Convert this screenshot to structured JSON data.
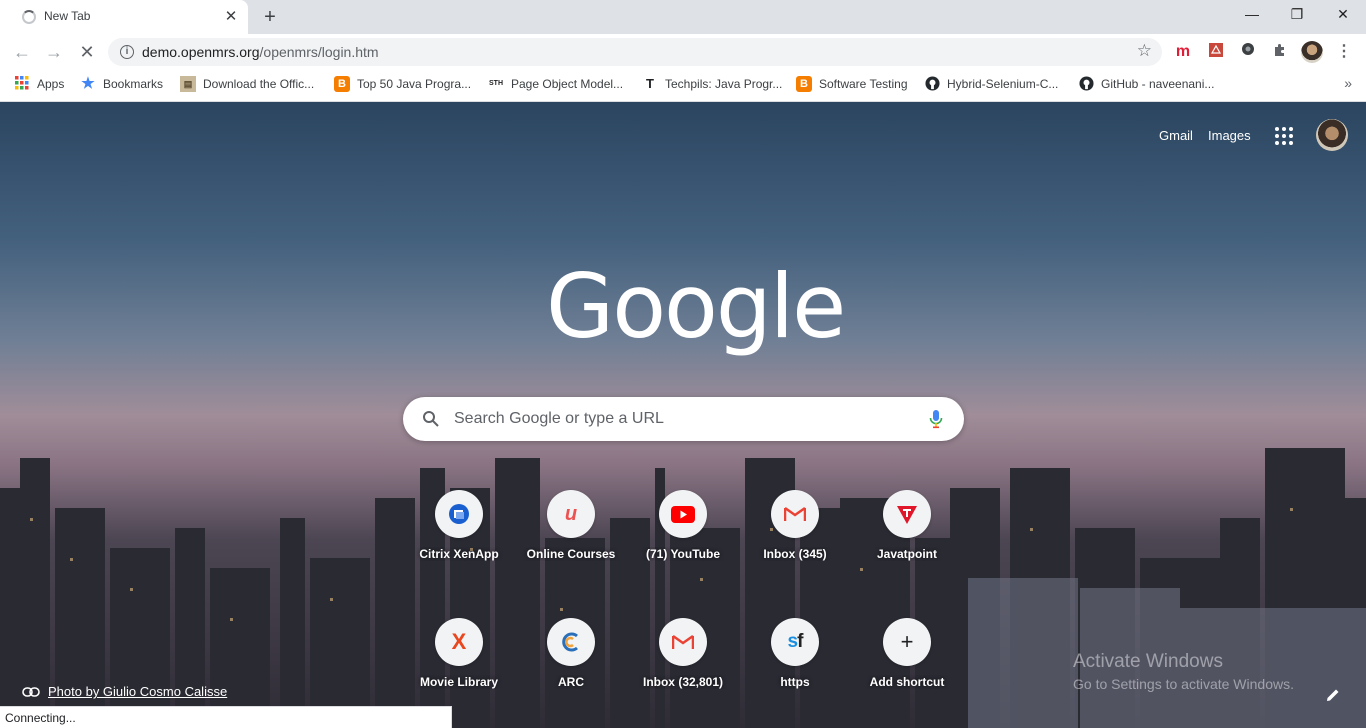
{
  "browser": {
    "tab_title": "New Tab",
    "url_host": "demo.openmrs.org",
    "url_path": "/openmrs/login.htm",
    "status": "Connecting..."
  },
  "bookmarks": [
    {
      "label": "Apps",
      "icon": "apps-grid-icon"
    },
    {
      "label": "Bookmarks",
      "icon": "star-icon"
    },
    {
      "label": "Download the Offic...",
      "icon": "page-icon"
    },
    {
      "label": "Top 50 Java Progra...",
      "icon": "blogger-icon"
    },
    {
      "label": "Page Object Model...",
      "icon": "sth-icon"
    },
    {
      "label": "Techpils: Java Progr...",
      "icon": "t-icon"
    },
    {
      "label": "Software Testing",
      "icon": "blogger-icon"
    },
    {
      "label": "Hybrid-Selenium-C...",
      "icon": "github-icon"
    },
    {
      "label": "GitHub - naveenani...",
      "icon": "github-icon"
    }
  ],
  "ntp": {
    "gmail": "Gmail",
    "images": "Images",
    "logo": "Google",
    "search_placeholder": "Search Google or type a URL",
    "attribution": "Photo by Giulio Cosmo Calisse",
    "watermark_title": "Activate Windows",
    "watermark_sub": "Go to Settings to activate Windows."
  },
  "shortcuts": [
    {
      "label": "Citrix XenApp",
      "icon": "citrix-icon"
    },
    {
      "label": "Online Courses",
      "icon": "udemy-icon"
    },
    {
      "label": "(71) YouTube",
      "icon": "youtube-icon"
    },
    {
      "label": "Inbox (345)",
      "icon": "gmail-icon"
    },
    {
      "label": "Javatpoint",
      "icon": "javatpoint-icon"
    },
    {
      "label": "Movie Library",
      "icon": "x-icon"
    },
    {
      "label": "ARC",
      "icon": "arc-icon"
    },
    {
      "label": "Inbox (32,801)",
      "icon": "gmail-icon"
    },
    {
      "label": "https",
      "icon": "sf-icon"
    },
    {
      "label": "Add shortcut",
      "icon": "plus-icon"
    }
  ],
  "colors": {
    "accent_red": "#ea4335",
    "youtube_red": "#ff0000",
    "google_blue": "#4285f4"
  }
}
